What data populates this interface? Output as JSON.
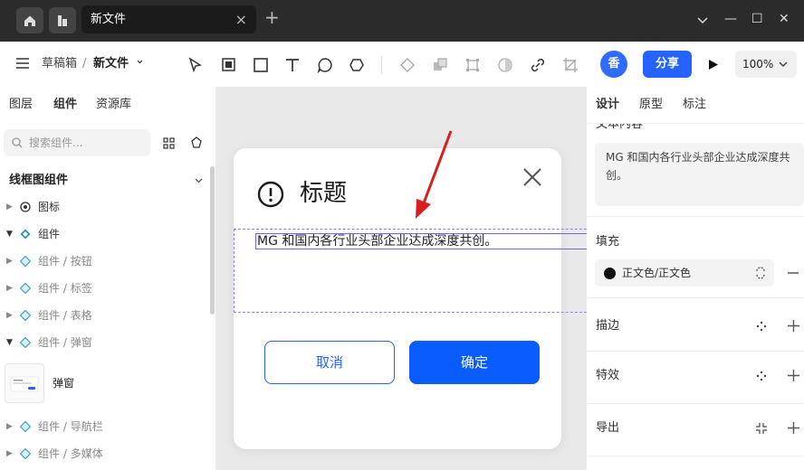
{
  "titlebar": {
    "tab_title": "新文件",
    "tab_close": "×",
    "new_tab": "+",
    "minimize": "—",
    "maximize": "☐",
    "close": "✕"
  },
  "toolbar": {
    "breadcrumb_root": "草稿箱",
    "breadcrumb_sep": "/",
    "file_name": "新文件",
    "file_chevron": "⌄",
    "avatar": "香",
    "share_label": "分享",
    "zoom": "100%",
    "tools": [
      "pointer-tool-icon",
      "frame-tool-icon",
      "rectangle-tool-icon",
      "text-tool-icon",
      "comment-tool-icon",
      "pen-tool-icon",
      "component-tool-icon",
      "boolean-tool-icon",
      "align-tool-icon",
      "mask-tool-icon",
      "link-tool-icon",
      "crop-tool-icon"
    ]
  },
  "left_panel": {
    "tabs": [
      "图层",
      "组件",
      "资源库"
    ],
    "active_tab": "组件",
    "search_placeholder": "搜索组件...",
    "section_title": "线框图组件",
    "items": [
      {
        "label": "图标",
        "expanded": false
      },
      {
        "label": "组件",
        "expanded": true
      },
      {
        "prefix": "组件",
        "label": "按钮",
        "expanded": false
      },
      {
        "prefix": "组件",
        "label": "标签",
        "expanded": false
      },
      {
        "prefix": "组件",
        "label": "表格",
        "expanded": false
      },
      {
        "prefix": "组件",
        "label": "弹窗",
        "expanded": true
      },
      {
        "label": "弹窗",
        "thumbnail": true
      },
      {
        "prefix": "组件",
        "label": "导航栏",
        "expanded": false
      },
      {
        "prefix": "组件",
        "label": "多媒体",
        "expanded": false
      }
    ]
  },
  "canvas": {
    "dialog_title": "标题",
    "dialog_text": "MG 和国内各行业头部企业达成深度共创。",
    "cancel_label": "取消",
    "confirm_label": "确定"
  },
  "right_panel": {
    "tabs": [
      "设计",
      "原型",
      "标注"
    ],
    "active_tab": "设计",
    "text_content_label": "文本内容",
    "text_content_value": "MG 和国内各行业头部企业达成深度共创。",
    "fill_label": "填充",
    "fill_value": "正文色/正文色",
    "stroke_label": "描边",
    "effects_label": "特效",
    "export_label": "导出"
  },
  "colors": {
    "accent": "#2563ff",
    "primary_button": "#0a5cff",
    "selection": "#7c5cff",
    "annotation_arrow": "#d81e1e",
    "titlebar": "#2b2b2b",
    "canvas": "#e9e9e9"
  }
}
